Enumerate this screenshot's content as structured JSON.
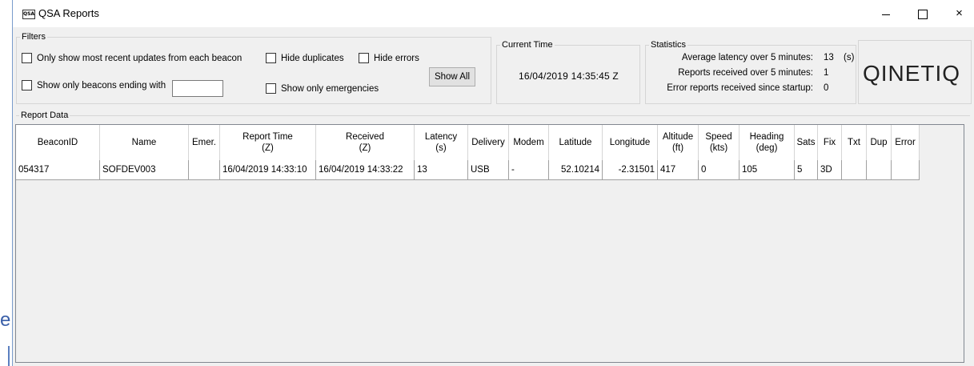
{
  "window": {
    "title": "QSA Reports",
    "icon_text": "QSA",
    "controls": {
      "minimize": "minimize-icon",
      "maximize": "maximize-icon",
      "close": "×"
    }
  },
  "filters": {
    "legend": "Filters",
    "most_recent": "Only show most recent updates from each beacon",
    "hide_duplicates": "Hide duplicates",
    "hide_errors": "Hide errors",
    "ending_with": "Show only beacons ending with",
    "ending_with_value": "",
    "emergencies": "Show only emergencies",
    "show_all": "Show All"
  },
  "current_time": {
    "legend": "Current Time",
    "value": "16/04/2019 14:35:45  Z"
  },
  "statistics": {
    "legend": "Statistics",
    "rows": [
      {
        "label": "Average latency over 5 minutes:",
        "value": "13",
        "unit": "(s)"
      },
      {
        "label": "Reports received over 5 minutes:",
        "value": "1",
        "unit": ""
      },
      {
        "label": "Error reports received since startup:",
        "value": "0",
        "unit": ""
      }
    ]
  },
  "logo": {
    "text": "QINETIQ"
  },
  "report": {
    "legend": "Report Data",
    "columns": [
      [
        "BeaconID",
        ""
      ],
      [
        "Name",
        ""
      ],
      [
        "Emer.",
        ""
      ],
      [
        "Report Time",
        "(Z)"
      ],
      [
        "Received",
        "(Z)"
      ],
      [
        "Latency",
        "(s)"
      ],
      [
        "Delivery",
        ""
      ],
      [
        "Modem",
        ""
      ],
      [
        "Latitude",
        ""
      ],
      [
        "Longitude",
        ""
      ],
      [
        "Altitude",
        "(ft)"
      ],
      [
        "Speed",
        "(kts)"
      ],
      [
        "Heading",
        "(deg)"
      ],
      [
        "Sats",
        ""
      ],
      [
        "Fix",
        ""
      ],
      [
        "Txt",
        ""
      ],
      [
        "Dup",
        ""
      ],
      [
        "Error",
        ""
      ]
    ],
    "rows": [
      [
        "054317",
        "SOFDEV003",
        "",
        "16/04/2019 14:33:10",
        "16/04/2019 14:33:22",
        "13",
        "USB",
        "-",
        "52.10214",
        "-2.31501",
        "417",
        "0",
        "105",
        "5",
        "3D",
        "",
        "",
        ""
      ]
    ]
  },
  "colors": {
    "window_bg": "#f0f0f0",
    "grid_bg": "#ffffff",
    "border": "#d5d5d5"
  }
}
